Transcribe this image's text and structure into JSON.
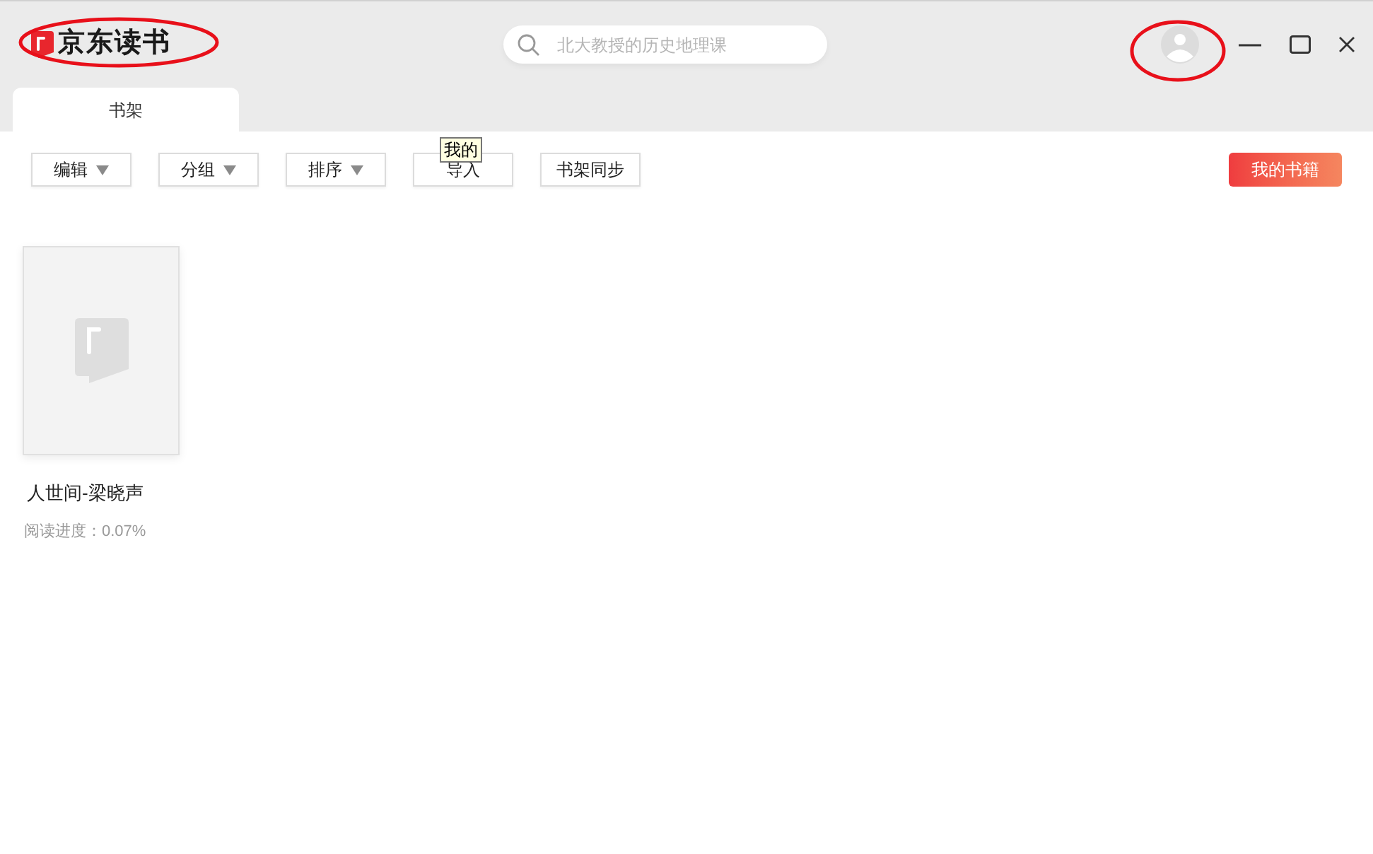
{
  "app": {
    "logo_text": "京东读书"
  },
  "search": {
    "placeholder": "北大教授的历史地理课"
  },
  "tabs": [
    {
      "label": "书架",
      "selected": true
    }
  ],
  "toolbar": [
    {
      "label": "编辑",
      "kind": "dropdown"
    },
    {
      "label": "分组",
      "kind": "dropdown"
    },
    {
      "label": "排序",
      "kind": "dropdown"
    },
    {
      "label": "导入",
      "kind": "plain"
    },
    {
      "label": "书架同步",
      "kind": "plain"
    }
  ],
  "tooltip": "我的",
  "my_books_button": "我的书籍",
  "books": [
    {
      "title": "人世间-梁晓声",
      "progress": "阅读进度：0.07%"
    }
  ]
}
